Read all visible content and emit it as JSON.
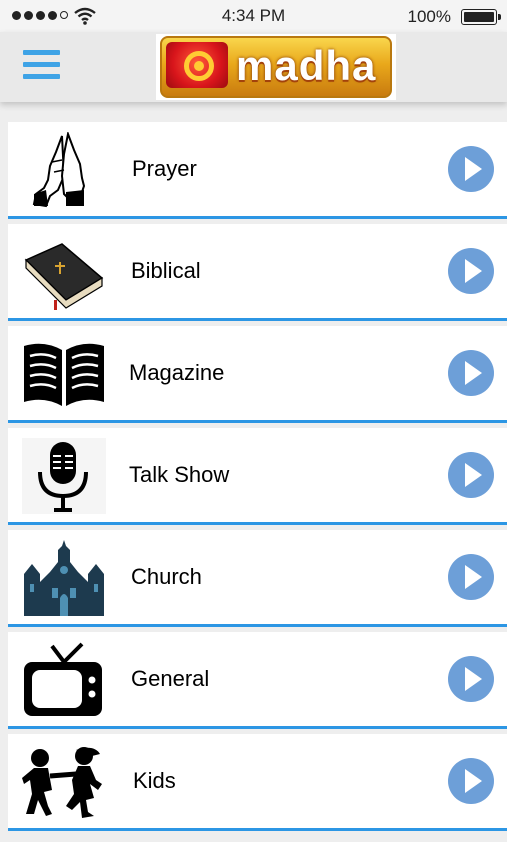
{
  "status_bar": {
    "time": "4:34 PM",
    "battery_percent": "100%",
    "signal_bars_filled": 4,
    "signal_bars_total": 5
  },
  "header": {
    "menu_icon": "hamburger-menu-icon",
    "logo_text": "madha",
    "accent_color": "#3ea3e6"
  },
  "categories": [
    {
      "label": "Prayer",
      "icon": "praying-hands-icon"
    },
    {
      "label": "Biblical",
      "icon": "bible-book-icon"
    },
    {
      "label": "Magazine",
      "icon": "open-book-icon"
    },
    {
      "label": "Talk Show",
      "icon": "microphone-icon"
    },
    {
      "label": "Church",
      "icon": "church-icon"
    },
    {
      "label": "General",
      "icon": "television-icon"
    },
    {
      "label": "Kids",
      "icon": "kids-dancing-icon"
    }
  ],
  "colors": {
    "divider": "#2c96e4",
    "play_button": "#6d9fd8"
  }
}
